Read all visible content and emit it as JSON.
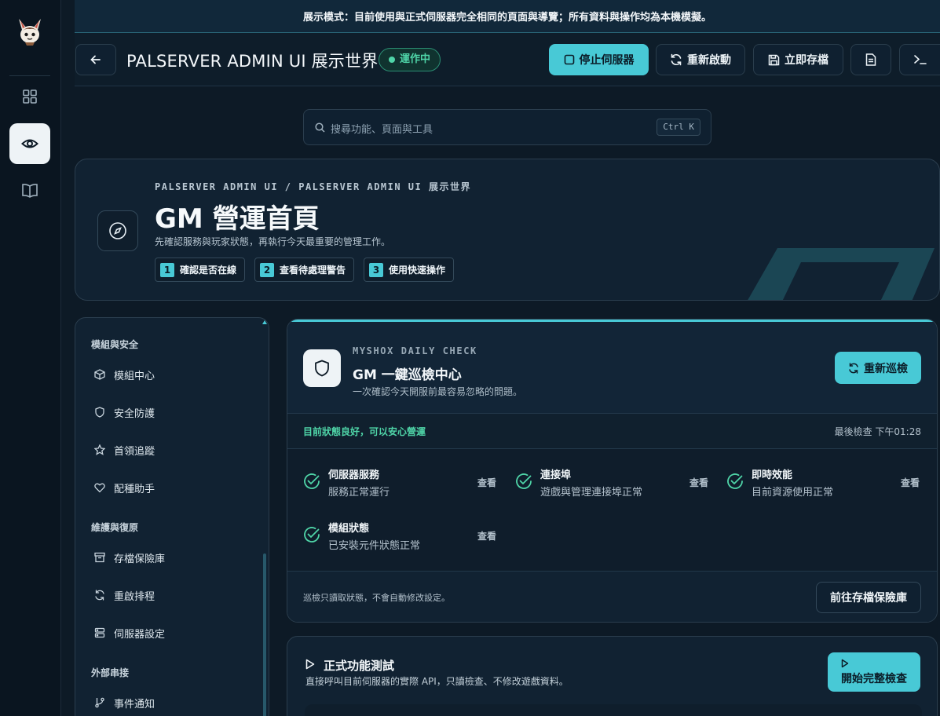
{
  "banner": {
    "text": "展示模式：目前使用與正式伺服器完全相同的頁面與導覽；所有資料與操作均為本機模擬。"
  },
  "rail": {
    "icons": [
      "mascot-logo",
      "grid-icon",
      "eye-icon",
      "book-icon"
    ]
  },
  "header": {
    "title": "PALSERVER ADMIN UI 展示世界",
    "status": "運作中",
    "buttons": {
      "stop": "停止伺服器",
      "restart": "重新啟動",
      "save": "立即存檔"
    }
  },
  "search": {
    "placeholder": "搜尋功能、頁面與工具",
    "shortcut": "Ctrl K"
  },
  "hero": {
    "breadcrumb": "PALSERVER ADMIN UI / PALSERVER ADMIN UI 展示世界",
    "title": "GM 營運首頁",
    "subtitle": "先確認服務與玩家狀態，再執行今天最重要的管理工作。",
    "steps": [
      {
        "num": "1",
        "label": "確認是否在線"
      },
      {
        "num": "2",
        "label": "查看待處理警告"
      },
      {
        "num": "3",
        "label": "使用快速操作"
      }
    ]
  },
  "nav": {
    "groups": [
      {
        "title": "模組與安全",
        "items": [
          "模組中心",
          "安全防護",
          "首領追蹤",
          "配種助手"
        ]
      },
      {
        "title": "維護與復原",
        "items": [
          "存檔保險庫",
          "重啟排程",
          "伺服器設定"
        ]
      },
      {
        "title": "外部串接",
        "items": [
          "事件通知"
        ]
      }
    ]
  },
  "check": {
    "eyebrow": "MYSHOX DAILY CHECK",
    "title": "GM 一鍵巡檢中心",
    "subtitle": "一次確認今天開服前最容易忽略的問題。",
    "rerun": "重新巡檢",
    "ok_text": "目前狀態良好，可以安心營運",
    "last_check": "最後檢查 下午01:28",
    "services": [
      {
        "name": "伺服器服務",
        "desc": "服務正常運行",
        "action": "查看"
      },
      {
        "name": "連接埠",
        "desc": "遊戲與管理連接埠正常",
        "action": "查看"
      },
      {
        "name": "即時效能",
        "desc": "目前資源使用正常",
        "action": "查看"
      },
      {
        "name": "模組狀態",
        "desc": "已安裝元件狀態正常",
        "action": "查看"
      }
    ],
    "footnote": "巡檢只讀取狀態，不會自動修改設定。",
    "vault_button": "前往存檔保險庫"
  },
  "feature_test": {
    "title": "正式功能測試",
    "subtitle": "直接呼叫目前伺服器的實際 API，只讀檢查、不修改遊戲資料。",
    "start_button": "開始完整檢查"
  },
  "colors": {
    "accent": "#48c9d6",
    "success": "#4fd5a8",
    "background": "#0d1a26",
    "card": "#112232"
  }
}
